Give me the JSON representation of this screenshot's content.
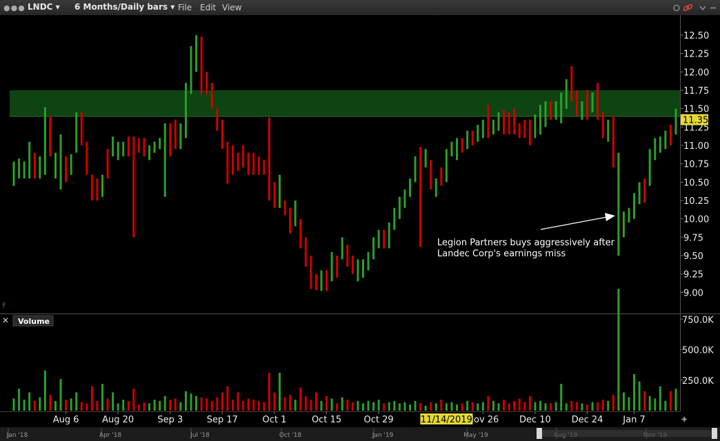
{
  "window": {
    "symbol": "LNDC",
    "symbol_caret": "▾",
    "period": "6 Months/Daily bars",
    "period_caret": "▾",
    "menus": [
      "File",
      "Edit",
      "View"
    ],
    "icons": [
      "window-dots-icon",
      "settings-icon",
      "link-icon",
      "collapse-chevron-icon"
    ]
  },
  "chart_data": {
    "type": "ohlc",
    "symbol": "LNDC",
    "price_axis": {
      "ticks": [
        "12.50",
        "12.25",
        "12.00",
        "11.75",
        "11.50",
        "11.25",
        "11.00",
        "10.75",
        "10.50",
        "10.25",
        "10.00",
        "9.75",
        "9.50",
        "9.25",
        "9.00"
      ],
      "range": [
        8.85,
        12.7
      ]
    },
    "last_price": "11.35",
    "highlight_band": [
      11.4,
      11.75
    ],
    "x_dates": [
      "Aug 6",
      "Aug 20",
      "Sep 3",
      "Sep 17",
      "Oct 1",
      "Oct 15",
      "Oct 29",
      "Nov 26",
      "Dec 10",
      "Dec 24",
      "Jan 7"
    ],
    "cursor_date": "11/14/2019",
    "annotation": "Legion Partners buys aggressively after Landec Corp's earnings miss",
    "annotation_lines": [
      "Legion Partners buys aggressively after",
      "Landec Corp's earnings miss"
    ],
    "volume_panel": {
      "title": "Volume",
      "ticks": [
        "750.0K",
        "500.0K",
        "250.0K"
      ],
      "range": [
        0,
        1000000
      ]
    },
    "navigator_labels": [
      "Jan '18",
      "Apr '18",
      "Jul '18",
      "Oct '18",
      "Jan '19",
      "May '19",
      "Aug '19",
      "Nov '19"
    ],
    "colors": {
      "up": "#2ca02c",
      "down": "#d00000",
      "band": "#0f4a14",
      "last_price_bg": "#e6d83a",
      "cursor_bg": "#e6d83a"
    },
    "bars": [
      {
        "o": 10.7,
        "h": 10.78,
        "l": 10.45,
        "c": 10.72,
        "v": 100000
      },
      {
        "o": 10.6,
        "h": 10.82,
        "l": 10.55,
        "c": 10.75,
        "v": 180000
      },
      {
        "o": 10.65,
        "h": 10.78,
        "l": 10.55,
        "c": 10.7,
        "v": 90000
      },
      {
        "o": 10.7,
        "h": 11.05,
        "l": 10.55,
        "c": 10.95,
        "v": 150000
      },
      {
        "o": 10.85,
        "h": 10.9,
        "l": 10.55,
        "c": 10.6,
        "v": 80000
      },
      {
        "o": 10.6,
        "h": 10.85,
        "l": 10.55,
        "c": 10.75,
        "v": 110000
      },
      {
        "o": 10.9,
        "h": 11.52,
        "l": 10.6,
        "c": 11.35,
        "v": 330000
      },
      {
        "o": 11.25,
        "h": 11.4,
        "l": 10.85,
        "c": 10.9,
        "v": 130000
      },
      {
        "o": 10.75,
        "h": 10.9,
        "l": 10.55,
        "c": 10.85,
        "v": 80000
      },
      {
        "o": 10.4,
        "h": 11.15,
        "l": 10.4,
        "c": 11.0,
        "v": 260000
      },
      {
        "o": 10.75,
        "h": 10.85,
        "l": 10.5,
        "c": 10.55,
        "v": 90000
      },
      {
        "o": 10.7,
        "h": 10.88,
        "l": 10.6,
        "c": 10.8,
        "v": 100000
      },
      {
        "o": 11.0,
        "h": 11.45,
        "l": 10.9,
        "c": 11.4,
        "v": 150000
      },
      {
        "o": 11.3,
        "h": 11.45,
        "l": 11.0,
        "c": 11.05,
        "v": 70000
      },
      {
        "o": 11.05,
        "h": 11.05,
        "l": 10.6,
        "c": 10.65,
        "v": 60000
      },
      {
        "o": 10.6,
        "h": 10.6,
        "l": 10.25,
        "c": 10.4,
        "v": 200000
      },
      {
        "o": 10.5,
        "h": 10.55,
        "l": 10.25,
        "c": 10.3,
        "v": 80000
      },
      {
        "o": 10.5,
        "h": 10.6,
        "l": 10.3,
        "c": 10.55,
        "v": 220000
      },
      {
        "o": 10.85,
        "h": 10.95,
        "l": 10.55,
        "c": 10.6,
        "v": 100000
      },
      {
        "o": 10.9,
        "h": 11.12,
        "l": 10.85,
        "c": 11.1,
        "v": 150000
      },
      {
        "o": 10.9,
        "h": 11.05,
        "l": 10.8,
        "c": 10.95,
        "v": 60000
      },
      {
        "o": 10.95,
        "h": 11.05,
        "l": 10.85,
        "c": 11.05,
        "v": 90000
      },
      {
        "o": 11.05,
        "h": 11.12,
        "l": 10.85,
        "c": 10.9,
        "v": 80000
      },
      {
        "o": 11.0,
        "h": 11.12,
        "l": 9.75,
        "c": 10.9,
        "v": 180000
      },
      {
        "o": 11.05,
        "h": 11.1,
        "l": 10.9,
        "c": 11.0,
        "v": 50000
      },
      {
        "o": 11.0,
        "h": 11.1,
        "l": 10.85,
        "c": 10.95,
        "v": 70000
      },
      {
        "o": 10.9,
        "h": 11.0,
        "l": 10.8,
        "c": 10.95,
        "v": 60000
      },
      {
        "o": 10.95,
        "h": 11.05,
        "l": 10.9,
        "c": 11.0,
        "v": 90000
      },
      {
        "o": 11.0,
        "h": 11.1,
        "l": 10.95,
        "c": 11.05,
        "v": 80000
      },
      {
        "o": 10.6,
        "h": 11.3,
        "l": 10.3,
        "c": 11.25,
        "v": 120000
      },
      {
        "o": 11.2,
        "h": 11.3,
        "l": 10.85,
        "c": 11.0,
        "v": 90000
      },
      {
        "o": 11.25,
        "h": 11.35,
        "l": 10.95,
        "c": 11.1,
        "v": 100000
      },
      {
        "o": 11.1,
        "h": 11.3,
        "l": 10.95,
        "c": 11.2,
        "v": 70000
      },
      {
        "o": 11.15,
        "h": 11.85,
        "l": 11.1,
        "c": 11.8,
        "v": 160000
      },
      {
        "o": 11.75,
        "h": 12.35,
        "l": 11.7,
        "c": 12.25,
        "v": 140000
      },
      {
        "o": 12.2,
        "h": 12.5,
        "l": 12.0,
        "c": 12.35,
        "v": 120000
      },
      {
        "o": 12.45,
        "h": 12.48,
        "l": 11.7,
        "c": 11.85,
        "v": 110000
      },
      {
        "o": 11.95,
        "h": 12.0,
        "l": 11.7,
        "c": 11.8,
        "v": 100000
      },
      {
        "o": 11.8,
        "h": 11.85,
        "l": 11.5,
        "c": 11.55,
        "v": 80000
      },
      {
        "o": 11.5,
        "h": 11.5,
        "l": 11.2,
        "c": 11.3,
        "v": 110000
      },
      {
        "o": 11.35,
        "h": 11.35,
        "l": 10.95,
        "c": 11.05,
        "v": 150000
      },
      {
        "o": 11.0,
        "h": 11.05,
        "l": 10.48,
        "c": 10.55,
        "v": 200000
      },
      {
        "o": 10.95,
        "h": 11.0,
        "l": 10.6,
        "c": 10.7,
        "v": 90000
      },
      {
        "o": 10.85,
        "h": 10.9,
        "l": 10.65,
        "c": 10.75,
        "v": 150000
      },
      {
        "o": 10.95,
        "h": 11.0,
        "l": 10.7,
        "c": 10.8,
        "v": 80000
      },
      {
        "o": 10.85,
        "h": 10.9,
        "l": 10.6,
        "c": 10.7,
        "v": 100000
      },
      {
        "o": 10.75,
        "h": 10.9,
        "l": 10.6,
        "c": 10.7,
        "v": 90000
      },
      {
        "o": 10.7,
        "h": 10.85,
        "l": 10.6,
        "c": 10.65,
        "v": 80000
      },
      {
        "o": 10.75,
        "h": 10.8,
        "l": 10.6,
        "c": 10.65,
        "v": 70000
      },
      {
        "o": 11.05,
        "h": 11.38,
        "l": 10.25,
        "c": 10.4,
        "v": 310000
      },
      {
        "o": 10.4,
        "h": 10.5,
        "l": 10.15,
        "c": 10.2,
        "v": 150000
      },
      {
        "o": 10.2,
        "h": 10.6,
        "l": 10.15,
        "c": 10.5,
        "v": 310000
      },
      {
        "o": 10.2,
        "h": 10.25,
        "l": 10.05,
        "c": 10.1,
        "v": 110000
      },
      {
        "o": 10.1,
        "h": 10.15,
        "l": 9.8,
        "c": 9.85,
        "v": 130000
      },
      {
        "o": 9.9,
        "h": 10.25,
        "l": 9.9,
        "c": 10.2,
        "v": 90000
      },
      {
        "o": 9.95,
        "h": 10.0,
        "l": 9.6,
        "c": 9.7,
        "v": 190000
      },
      {
        "o": 9.7,
        "h": 9.75,
        "l": 9.35,
        "c": 9.45,
        "v": 120000
      },
      {
        "o": 9.45,
        "h": 9.5,
        "l": 9.05,
        "c": 9.1,
        "v": 90000
      },
      {
        "o": 9.2,
        "h": 9.25,
        "l": 9.03,
        "c": 9.08,
        "v": 150000
      },
      {
        "o": 9.05,
        "h": 9.3,
        "l": 9.02,
        "c": 9.25,
        "v": 80000
      },
      {
        "o": 9.2,
        "h": 9.3,
        "l": 9.02,
        "c": 9.05,
        "v": 120000
      },
      {
        "o": 9.2,
        "h": 9.55,
        "l": 9.15,
        "c": 9.5,
        "v": 100000
      },
      {
        "o": 9.45,
        "h": 9.5,
        "l": 9.2,
        "c": 9.3,
        "v": 60000
      },
      {
        "o": 9.5,
        "h": 9.75,
        "l": 9.45,
        "c": 9.7,
        "v": 110000
      },
      {
        "o": 9.5,
        "h": 9.65,
        "l": 9.35,
        "c": 9.4,
        "v": 90000
      },
      {
        "o": 9.4,
        "h": 9.5,
        "l": 9.25,
        "c": 9.3,
        "v": 70000
      },
      {
        "o": 9.25,
        "h": 9.45,
        "l": 9.15,
        "c": 9.4,
        "v": 80000
      },
      {
        "o": 9.3,
        "h": 9.45,
        "l": 9.2,
        "c": 9.4,
        "v": 60000
      },
      {
        "o": 9.35,
        "h": 9.55,
        "l": 9.3,
        "c": 9.5,
        "v": 80000
      },
      {
        "o": 9.5,
        "h": 9.75,
        "l": 9.45,
        "c": 9.7,
        "v": 70000
      },
      {
        "o": 9.65,
        "h": 9.85,
        "l": 9.6,
        "c": 9.8,
        "v": 90000
      },
      {
        "o": 9.7,
        "h": 9.85,
        "l": 9.6,
        "c": 9.65,
        "v": 60000
      },
      {
        "o": 9.65,
        "h": 9.95,
        "l": 9.6,
        "c": 9.9,
        "v": 70000
      },
      {
        "o": 9.9,
        "h": 10.15,
        "l": 9.85,
        "c": 10.1,
        "v": 80000
      },
      {
        "o": 10.05,
        "h": 10.3,
        "l": 10.0,
        "c": 10.25,
        "v": 60000
      },
      {
        "o": 10.3,
        "h": 10.4,
        "l": 10.15,
        "c": 10.35,
        "v": 70000
      },
      {
        "o": 10.4,
        "h": 10.55,
        "l": 10.3,
        "c": 10.5,
        "v": 50000
      },
      {
        "o": 10.55,
        "h": 10.85,
        "l": 10.5,
        "c": 10.8,
        "v": 80000
      },
      {
        "o": 10.9,
        "h": 10.98,
        "l": 9.62,
        "c": 10.6,
        "v": 60000
      },
      {
        "o": 10.8,
        "h": 10.95,
        "l": 10.7,
        "c": 10.9,
        "v": 40000
      },
      {
        "o": 10.75,
        "h": 10.8,
        "l": 10.4,
        "c": 10.5,
        "v": 70000
      },
      {
        "o": 10.35,
        "h": 10.55,
        "l": 10.3,
        "c": 10.5,
        "v": 60000
      },
      {
        "o": 10.65,
        "h": 10.7,
        "l": 10.45,
        "c": 10.6,
        "v": 90000
      },
      {
        "o": 10.55,
        "h": 10.95,
        "l": 10.5,
        "c": 10.9,
        "v": 60000
      },
      {
        "o": 10.95,
        "h": 11.05,
        "l": 10.85,
        "c": 10.95,
        "v": 70000
      },
      {
        "o": 10.9,
        "h": 11.1,
        "l": 10.8,
        "c": 11.05,
        "v": 50000
      },
      {
        "o": 11.05,
        "h": 11.1,
        "l": 10.9,
        "c": 10.95,
        "v": 60000
      },
      {
        "o": 11.0,
        "h": 11.2,
        "l": 10.95,
        "c": 11.15,
        "v": 80000
      },
      {
        "o": 11.1,
        "h": 11.2,
        "l": 11.0,
        "c": 11.05,
        "v": 70000
      },
      {
        "o": 11.1,
        "h": 11.28,
        "l": 11.05,
        "c": 11.25,
        "v": 60000
      },
      {
        "o": 11.15,
        "h": 11.35,
        "l": 11.1,
        "c": 11.3,
        "v": 70000
      },
      {
        "o": 11.35,
        "h": 11.55,
        "l": 11.1,
        "c": 11.15,
        "v": 120000
      },
      {
        "o": 11.2,
        "h": 11.35,
        "l": 11.15,
        "c": 11.3,
        "v": 80000
      },
      {
        "o": 11.3,
        "h": 11.45,
        "l": 11.2,
        "c": 11.4,
        "v": 60000
      },
      {
        "o": 11.4,
        "h": 11.48,
        "l": 11.15,
        "c": 11.25,
        "v": 90000
      },
      {
        "o": 11.3,
        "h": 11.45,
        "l": 11.15,
        "c": 11.2,
        "v": 60000
      },
      {
        "o": 11.35,
        "h": 11.5,
        "l": 11.15,
        "c": 11.2,
        "v": 80000
      },
      {
        "o": 11.2,
        "h": 11.3,
        "l": 11.1,
        "c": 11.15,
        "v": 100000
      },
      {
        "o": 11.3,
        "h": 11.35,
        "l": 11.1,
        "c": 11.2,
        "v": 70000
      },
      {
        "o": 11.25,
        "h": 11.35,
        "l": 11.0,
        "c": 11.05,
        "v": 120000
      },
      {
        "o": 11.15,
        "h": 11.42,
        "l": 11.1,
        "c": 11.35,
        "v": 70000
      },
      {
        "o": 11.35,
        "h": 11.55,
        "l": 11.15,
        "c": 11.5,
        "v": 80000
      },
      {
        "o": 11.45,
        "h": 11.6,
        "l": 11.25,
        "c": 11.55,
        "v": 60000
      },
      {
        "o": 11.55,
        "h": 11.6,
        "l": 11.35,
        "c": 11.4,
        "v": 60000
      },
      {
        "o": 11.4,
        "h": 11.6,
        "l": 11.35,
        "c": 11.55,
        "v": 70000
      },
      {
        "o": 11.45,
        "h": 11.72,
        "l": 11.3,
        "c": 11.65,
        "v": 220000
      },
      {
        "o": 11.7,
        "h": 11.9,
        "l": 11.5,
        "c": 11.8,
        "v": 60000
      },
      {
        "o": 11.9,
        "h": 12.08,
        "l": 11.6,
        "c": 11.7,
        "v": 80000
      },
      {
        "o": 11.7,
        "h": 11.75,
        "l": 11.4,
        "c": 11.5,
        "v": 70000
      },
      {
        "o": 11.4,
        "h": 11.6,
        "l": 11.35,
        "c": 11.55,
        "v": 60000
      },
      {
        "o": 11.6,
        "h": 11.75,
        "l": 11.35,
        "c": 11.45,
        "v": 50000
      },
      {
        "o": 11.5,
        "h": 11.72,
        "l": 11.45,
        "c": 11.65,
        "v": 70000
      },
      {
        "o": 11.75,
        "h": 11.85,
        "l": 11.35,
        "c": 11.4,
        "v": 70000
      },
      {
        "o": 11.4,
        "h": 11.45,
        "l": 11.1,
        "c": 11.2,
        "v": 90000
      },
      {
        "o": 11.15,
        "h": 11.35,
        "l": 11.05,
        "c": 11.3,
        "v": 80000
      },
      {
        "o": 11.25,
        "h": 11.4,
        "l": 10.7,
        "c": 10.75,
        "v": 130000
      },
      {
        "o": 10.5,
        "h": 10.9,
        "l": 9.5,
        "c": 10.8,
        "v": 1000000
      },
      {
        "o": 9.8,
        "h": 10.1,
        "l": 9.75,
        "c": 10.05,
        "v": 150000
      },
      {
        "o": 10.0,
        "h": 10.15,
        "l": 9.95,
        "c": 10.1,
        "v": 110000
      },
      {
        "o": 10.0,
        "h": 10.35,
        "l": 10.0,
        "c": 10.3,
        "v": 300000
      },
      {
        "o": 10.3,
        "h": 10.5,
        "l": 10.2,
        "c": 10.45,
        "v": 240000
      },
      {
        "o": 10.5,
        "h": 10.55,
        "l": 10.22,
        "c": 10.3,
        "v": 160000
      },
      {
        "o": 10.5,
        "h": 10.95,
        "l": 10.45,
        "c": 10.9,
        "v": 120000
      },
      {
        "o": 10.85,
        "h": 11.1,
        "l": 10.8,
        "c": 11.05,
        "v": 100000
      },
      {
        "o": 10.95,
        "h": 11.12,
        "l": 10.9,
        "c": 11.05,
        "v": 200000
      },
      {
        "o": 11.05,
        "h": 11.2,
        "l": 10.95,
        "c": 11.15,
        "v": 80000
      },
      {
        "o": 11.2,
        "h": 11.28,
        "l": 11.0,
        "c": 11.05,
        "v": 160000
      },
      {
        "o": 11.2,
        "h": 11.5,
        "l": 11.15,
        "c": 11.35,
        "v": 180000
      }
    ]
  }
}
